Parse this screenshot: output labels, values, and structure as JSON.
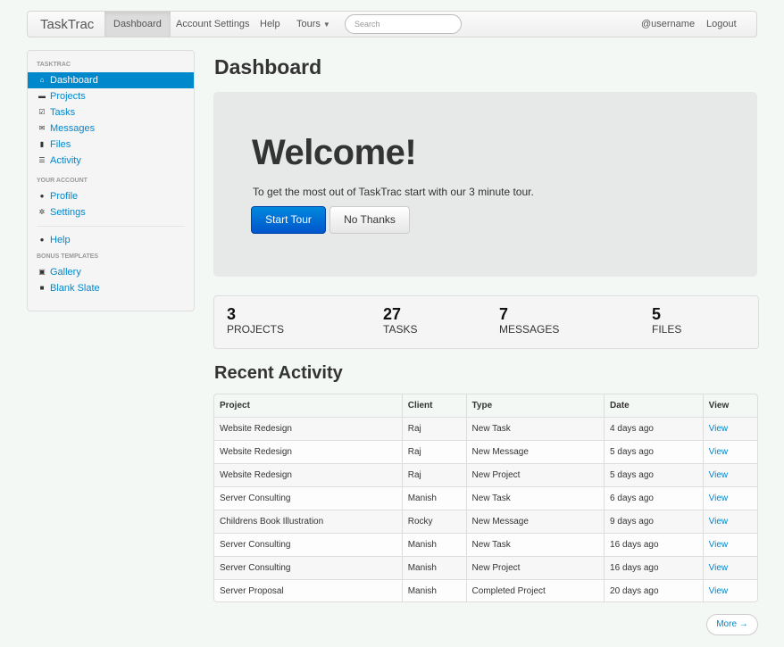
{
  "navbar": {
    "brand": "TaskTrac",
    "items": [
      "Dashboard",
      "Account Settings",
      "Help",
      "Tours"
    ],
    "search_placeholder": "Search",
    "username": "@username",
    "logout": "Logout"
  },
  "sidebar": {
    "sections": [
      {
        "heading": "TASKTRAC",
        "items": [
          {
            "label": "Dashboard",
            "icon": "home-icon",
            "glyph": "⌂"
          },
          {
            "label": "Projects",
            "icon": "folder-icon",
            "glyph": "▬"
          },
          {
            "label": "Tasks",
            "icon": "check-icon",
            "glyph": "☑"
          },
          {
            "label": "Messages",
            "icon": "envelope-icon",
            "glyph": "✉"
          },
          {
            "label": "Files",
            "icon": "file-icon",
            "glyph": "▮"
          },
          {
            "label": "Activity",
            "icon": "list-icon",
            "glyph": "☰"
          }
        ]
      },
      {
        "heading": "YOUR ACCOUNT",
        "items": [
          {
            "label": "Profile",
            "icon": "user-icon",
            "glyph": "●"
          },
          {
            "label": "Settings",
            "icon": "gear-icon",
            "glyph": "✲"
          }
        ]
      },
      {
        "heading": "",
        "items": [
          {
            "label": "Help",
            "icon": "info-icon",
            "glyph": "●"
          }
        ]
      },
      {
        "heading": "BONUS TEMPLATES",
        "items": [
          {
            "label": "Gallery",
            "icon": "picture-icon",
            "glyph": "▣"
          },
          {
            "label": "Blank Slate",
            "icon": "stop-icon",
            "glyph": "■"
          }
        ]
      }
    ]
  },
  "main": {
    "title": "Dashboard",
    "hero": {
      "title": "Welcome!",
      "text": "To get the most out of TaskTrac start with our 3 minute tour.",
      "primary": "Start Tour",
      "secondary": "No Thanks"
    },
    "stats": [
      {
        "value": "3",
        "label": "PROJECTS"
      },
      {
        "value": "27",
        "label": "TASKS"
      },
      {
        "value": "7",
        "label": "MESSAGES"
      },
      {
        "value": "5",
        "label": "FILES"
      }
    ],
    "activity_title": "Recent Activity",
    "table": {
      "columns": [
        "Project",
        "Client",
        "Type",
        "Date",
        "View"
      ],
      "rows": [
        [
          "Website Redesign",
          "Raj",
          "New Task",
          "4 days ago",
          "View"
        ],
        [
          "Website Redesign",
          "Raj",
          "New Message",
          "5 days ago",
          "View"
        ],
        [
          "Website Redesign",
          "Raj",
          "New Project",
          "5 days ago",
          "View"
        ],
        [
          "Server Consulting",
          "Manish",
          "New Task",
          "6 days ago",
          "View"
        ],
        [
          "Childrens Book Illustration",
          "Rocky",
          "New Message",
          "9 days ago",
          "View"
        ],
        [
          "Server Consulting",
          "Manish",
          "New Task",
          "16 days ago",
          "View"
        ],
        [
          "Server Consulting",
          "Manish",
          "New Project",
          "16 days ago",
          "View"
        ],
        [
          "Server Proposal",
          "Manish",
          "Completed Project",
          "20 days ago",
          "View"
        ]
      ]
    },
    "more": "More →"
  }
}
